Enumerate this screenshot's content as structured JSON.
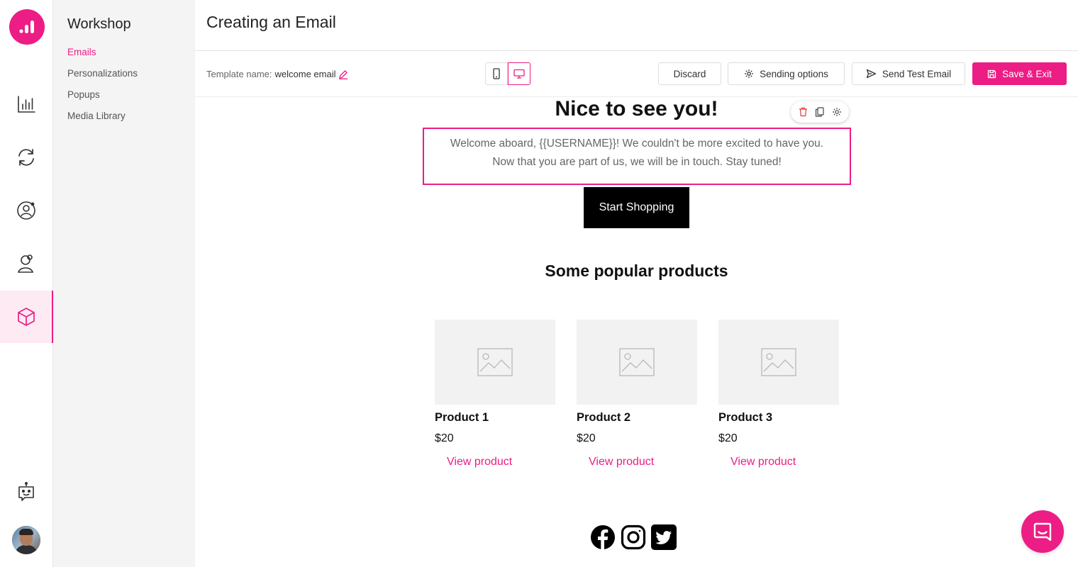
{
  "sidebar": {
    "title": "Workshop",
    "links": [
      {
        "label": "Emails",
        "active": true
      },
      {
        "label": "Personalizations",
        "active": false
      },
      {
        "label": "Popups",
        "active": false
      },
      {
        "label": "Media Library",
        "active": false
      }
    ]
  },
  "rail": {
    "items": [
      "analytics-icon",
      "refresh-icon",
      "user-circle-icon",
      "user-search-icon",
      "cube-icon"
    ],
    "active": "cube-icon",
    "bottom": [
      "bot-icon",
      "avatar"
    ]
  },
  "header": {
    "title": "Creating an Email"
  },
  "toolbar": {
    "template_label": "Template name:",
    "template_value": "welcome email",
    "discard_label": "Discard",
    "sending_options_label": "Sending options",
    "send_test_label": "Send Test Email",
    "save_exit_label": "Save & Exit"
  },
  "email": {
    "heading": "Nice to see you!",
    "welcome_line1": "Welcome aboard, {{USERNAME}}! We couldn't be more excited to have you.",
    "welcome_line2": "Now that you are part of us, we will be in touch. Stay tuned!",
    "cta_label": "Start Shopping",
    "section_title": "Some popular products",
    "products": [
      {
        "name": "Product 1",
        "price": "$20",
        "link": "View product"
      },
      {
        "name": "Product 2",
        "price": "$20",
        "link": "View product"
      },
      {
        "name": "Product 3",
        "price": "$20",
        "link": "View product"
      }
    ],
    "socials": [
      "facebook-icon",
      "instagram-icon",
      "twitter-icon"
    ]
  },
  "colors": {
    "accent": "#ec1d85",
    "sidebar_bg": "#f4f4f4",
    "rail_active_bg": "#fdeaf3"
  }
}
